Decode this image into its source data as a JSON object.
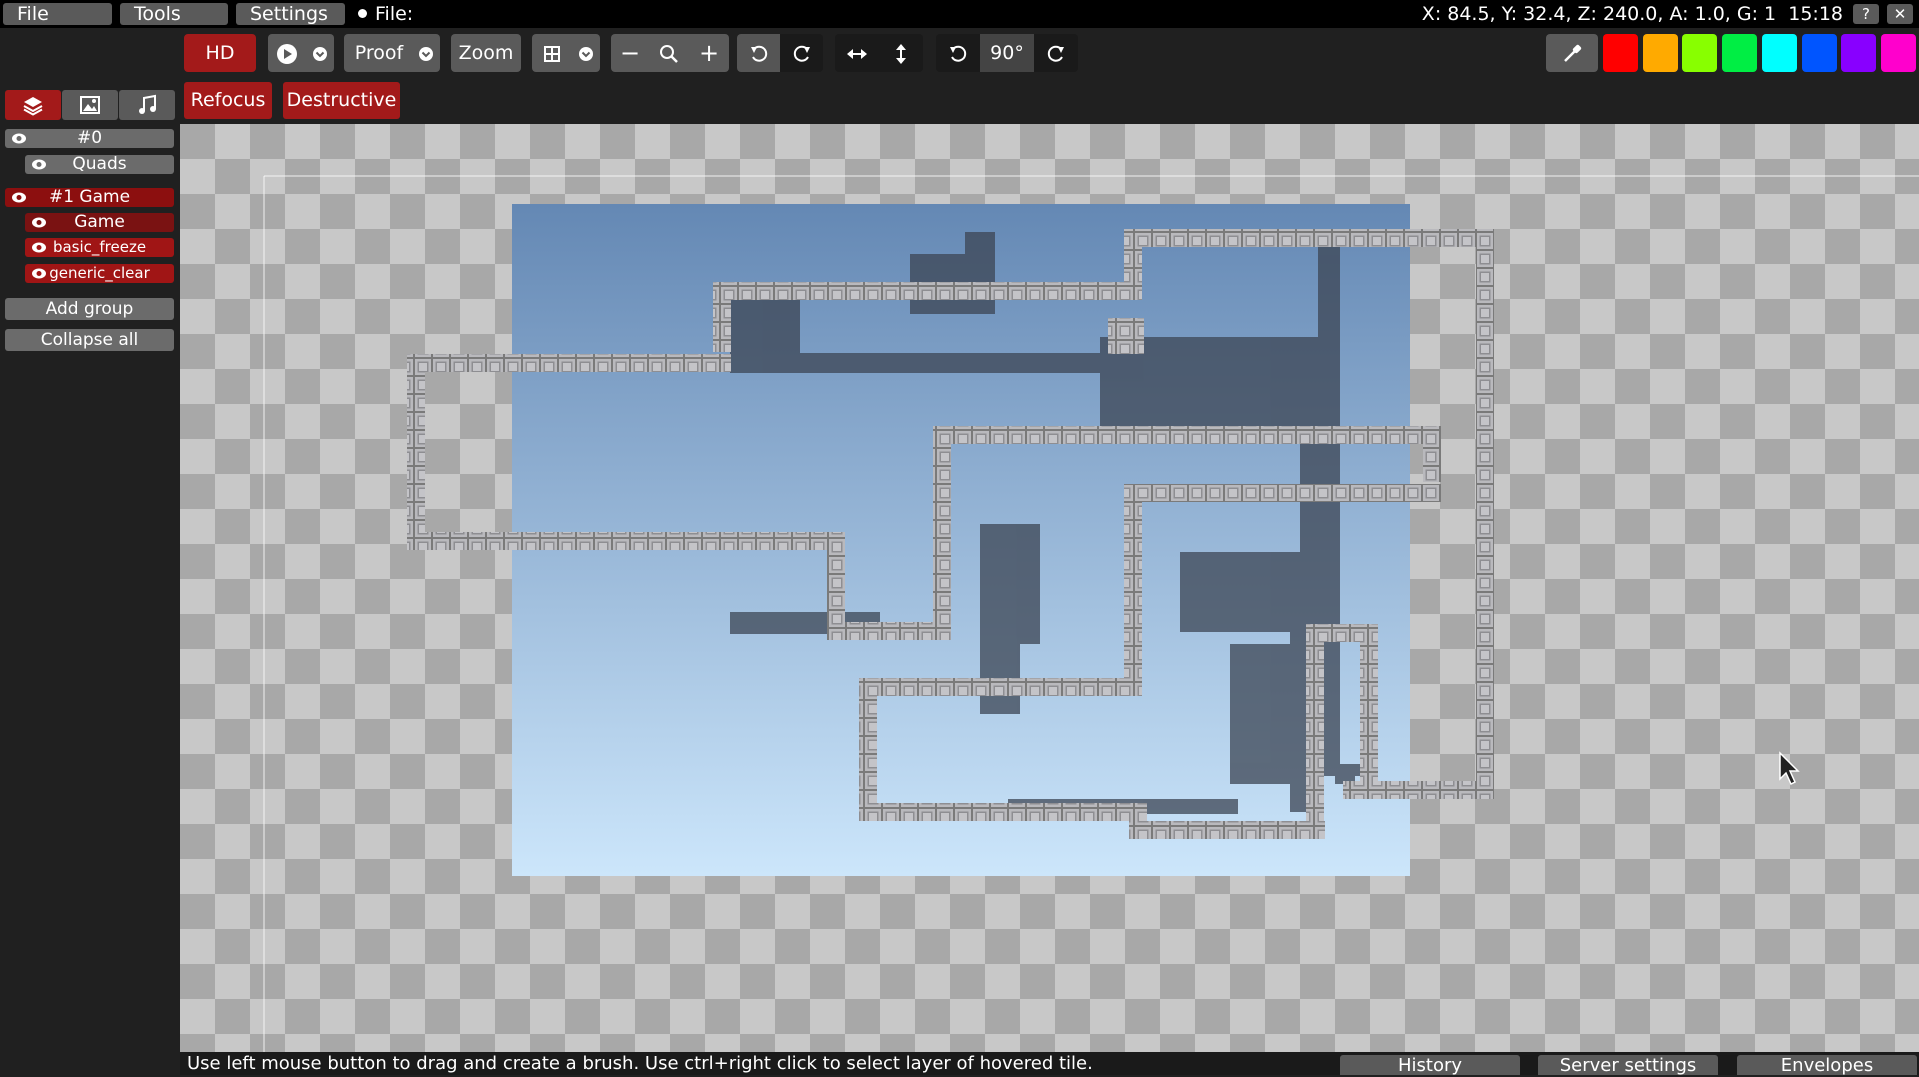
{
  "menu": {
    "file": "File",
    "tools": "Tools",
    "settings": "Settings",
    "file_status": "File:",
    "coords": "X: 84.5, Y: 32.4, Z: 240.0, A: 1.0, G: 1",
    "clock": "15:18",
    "help": "?",
    "close": "✕"
  },
  "toolbar": {
    "hd": "HD",
    "proof": "Proof",
    "zoom": "Zoom",
    "rotation": "90°",
    "colors": [
      "#ff0000",
      "#ffaa00",
      "#88ff00",
      "#00ee44",
      "#00ffff",
      "#0055ff",
      "#8800ff",
      "#ff00cc"
    ]
  },
  "options": {
    "refocus": "Refocus",
    "destructive": "Destructive"
  },
  "layers": {
    "group0": "#0",
    "quads": "Quads",
    "group1": "#1 Game",
    "game": "Game",
    "basic_freeze": "basic_freeze",
    "generic_clear": "generic_clear",
    "add_group": "Add group",
    "collapse_all": "Collapse all"
  },
  "status": {
    "text": "Use left mouse button to drag and create a brush. Use ctrl+right click to select layer of hovered tile.",
    "history": "History",
    "server_settings": "Server settings",
    "envelopes": "Envelopes"
  }
}
